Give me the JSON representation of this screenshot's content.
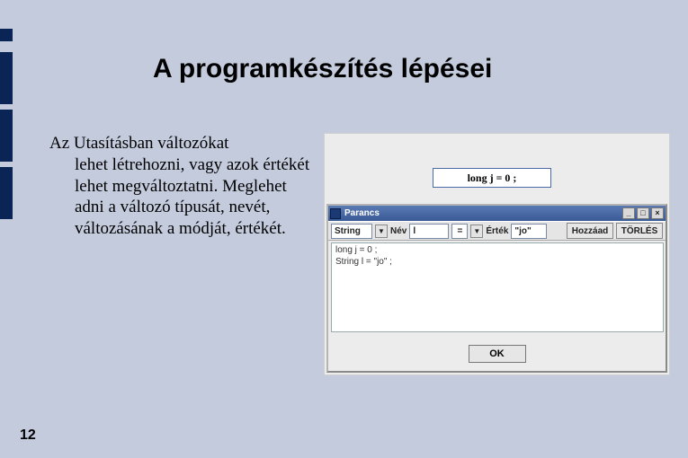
{
  "title": "A programkészítés lépései",
  "body": {
    "line1": "Az Utasításban változókat",
    "rest": "lehet létrehozni, vagy azok értékét lehet megváltoztatni. Meglehet adni a változó típusát, nevét, változásának a módját, értékét."
  },
  "codebox": "long j = 0 ;",
  "window": {
    "title": "Parancs",
    "min": "_",
    "max": "□",
    "close": "×"
  },
  "toolbar": {
    "type_value": "String",
    "name_label": "Név",
    "name_value": "l",
    "op_value": "=",
    "value_label": "Érték",
    "value_value": "\"jo\"",
    "add": "Hozzáad",
    "delete": "TÖRLÉS"
  },
  "editor": {
    "line1": "long j = 0 ;",
    "line2": "String l = \"jo\" ;"
  },
  "ok": "OK",
  "page": "12"
}
